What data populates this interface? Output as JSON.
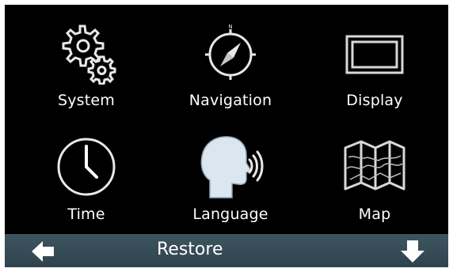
{
  "menu": {
    "tiles": [
      {
        "label": "System",
        "icon": "gears-icon"
      },
      {
        "label": "Navigation",
        "icon": "compass-icon"
      },
      {
        "label": "Display",
        "icon": "display-icon"
      },
      {
        "label": "Time",
        "icon": "clock-icon"
      },
      {
        "label": "Language",
        "icon": "speaking-head-icon"
      },
      {
        "label": "Map",
        "icon": "folded-map-icon"
      }
    ]
  },
  "bottombar": {
    "restore_label": "Restore",
    "back_icon": "arrow-left-icon",
    "scroll_icon": "arrow-down-icon",
    "background": "#3a4f59"
  }
}
